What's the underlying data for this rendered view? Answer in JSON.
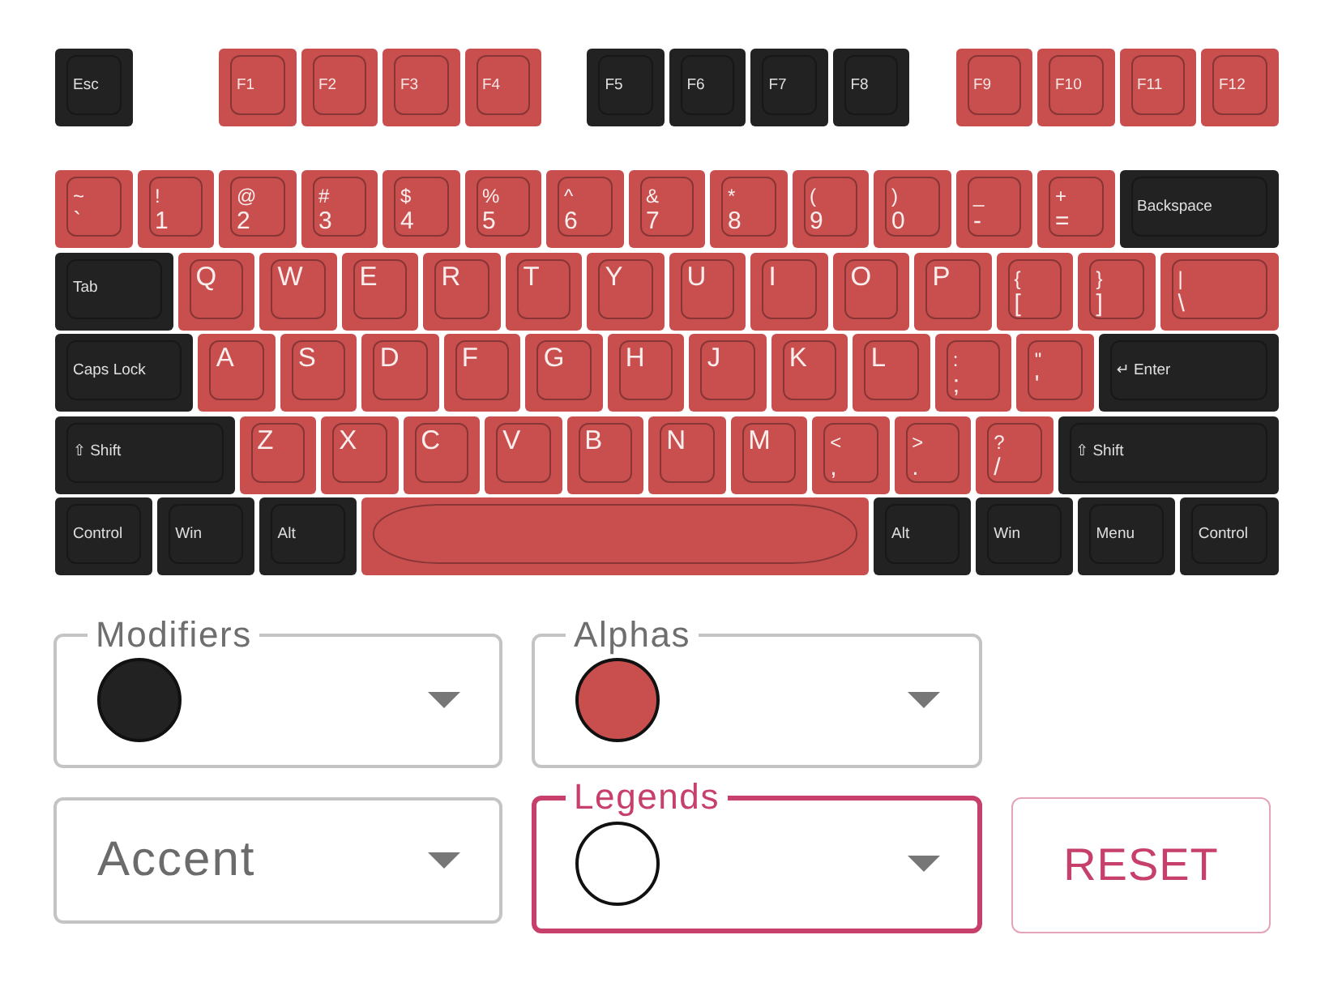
{
  "keyboard": {
    "rows": [
      {
        "keys": [
          {
            "kind": "modifier",
            "legends": [
              "Esc"
            ]
          },
          {
            "kind": "function",
            "legends": [
              "F1"
            ]
          },
          {
            "kind": "function",
            "legends": [
              "F2"
            ]
          },
          {
            "kind": "function",
            "legends": [
              "F3"
            ]
          },
          {
            "kind": "function",
            "legends": [
              "F4"
            ]
          },
          {
            "kind": "modifier",
            "legends": [
              "F5"
            ]
          },
          {
            "kind": "modifier",
            "legends": [
              "F6"
            ]
          },
          {
            "kind": "modifier",
            "legends": [
              "F7"
            ]
          },
          {
            "kind": "modifier",
            "legends": [
              "F8"
            ]
          },
          {
            "kind": "function",
            "legends": [
              "F9"
            ]
          },
          {
            "kind": "function",
            "legends": [
              "F10"
            ]
          },
          {
            "kind": "function",
            "legends": [
              "F11"
            ]
          },
          {
            "kind": "function",
            "legends": [
              "F12"
            ]
          }
        ]
      },
      {
        "keys": [
          {
            "kind": "pair",
            "legends": [
              "~",
              "`"
            ]
          },
          {
            "kind": "pair",
            "legends": [
              "!",
              "1"
            ]
          },
          {
            "kind": "pair",
            "legends": [
              "@",
              "2"
            ]
          },
          {
            "kind": "pair",
            "legends": [
              "#",
              "3"
            ]
          },
          {
            "kind": "pair",
            "legends": [
              "$",
              "4"
            ]
          },
          {
            "kind": "pair",
            "legends": [
              "%",
              "5"
            ]
          },
          {
            "kind": "pair",
            "legends": [
              "^",
              "6"
            ]
          },
          {
            "kind": "pair",
            "legends": [
              "&",
              "7"
            ]
          },
          {
            "kind": "pair",
            "legends": [
              "*",
              "8"
            ]
          },
          {
            "kind": "pair",
            "legends": [
              "(",
              "9"
            ]
          },
          {
            "kind": "pair",
            "legends": [
              ")",
              "0"
            ]
          },
          {
            "kind": "pair",
            "legends": [
              "_",
              "-"
            ]
          },
          {
            "kind": "pair",
            "legends": [
              "+",
              "="
            ]
          },
          {
            "kind": "modifier",
            "legends": [
              "Backspace"
            ]
          }
        ]
      },
      {
        "keys": [
          {
            "kind": "modifier",
            "legends": [
              "Tab"
            ]
          },
          {
            "kind": "letter",
            "legends": [
              "Q"
            ]
          },
          {
            "kind": "letter",
            "legends": [
              "W"
            ]
          },
          {
            "kind": "letter",
            "legends": [
              "E"
            ]
          },
          {
            "kind": "letter",
            "legends": [
              "R"
            ]
          },
          {
            "kind": "letter",
            "legends": [
              "T"
            ]
          },
          {
            "kind": "letter",
            "legends": [
              "Y"
            ]
          },
          {
            "kind": "letter",
            "legends": [
              "U"
            ]
          },
          {
            "kind": "letter",
            "legends": [
              "I"
            ]
          },
          {
            "kind": "letter",
            "legends": [
              "O"
            ]
          },
          {
            "kind": "letter",
            "legends": [
              "P"
            ]
          },
          {
            "kind": "pair",
            "legends": [
              "{",
              "["
            ]
          },
          {
            "kind": "pair",
            "legends": [
              "}",
              "]"
            ]
          },
          {
            "kind": "pair",
            "legends": [
              "|",
              "\\"
            ]
          }
        ]
      },
      {
        "keys": [
          {
            "kind": "modifier",
            "legends": [
              "Caps Lock"
            ]
          },
          {
            "kind": "letter",
            "legends": [
              "A"
            ]
          },
          {
            "kind": "letter",
            "legends": [
              "S"
            ]
          },
          {
            "kind": "letter",
            "legends": [
              "D"
            ]
          },
          {
            "kind": "letter",
            "legends": [
              "F"
            ]
          },
          {
            "kind": "letter",
            "legends": [
              "G"
            ]
          },
          {
            "kind": "letter",
            "legends": [
              "H"
            ]
          },
          {
            "kind": "letter",
            "legends": [
              "J"
            ]
          },
          {
            "kind": "letter",
            "legends": [
              "K"
            ]
          },
          {
            "kind": "letter",
            "legends": [
              "L"
            ]
          },
          {
            "kind": "pair",
            "legends": [
              ":",
              ";"
            ]
          },
          {
            "kind": "pair",
            "legends": [
              "\"",
              "'"
            ]
          },
          {
            "kind": "modifier",
            "legends": [
              "↵ Enter"
            ]
          }
        ]
      },
      {
        "keys": [
          {
            "kind": "modifier",
            "legends": [
              "⇧ Shift"
            ]
          },
          {
            "kind": "letter",
            "legends": [
              "Z"
            ]
          },
          {
            "kind": "letter",
            "legends": [
              "X"
            ]
          },
          {
            "kind": "letter",
            "legends": [
              "C"
            ]
          },
          {
            "kind": "letter",
            "legends": [
              "V"
            ]
          },
          {
            "kind": "letter",
            "legends": [
              "B"
            ]
          },
          {
            "kind": "letter",
            "legends": [
              "N"
            ]
          },
          {
            "kind": "letter",
            "legends": [
              "M"
            ]
          },
          {
            "kind": "pair",
            "legends": [
              "<",
              ","
            ]
          },
          {
            "kind": "pair",
            "legends": [
              ">",
              "."
            ]
          },
          {
            "kind": "pair",
            "legends": [
              "?",
              "/"
            ]
          },
          {
            "kind": "modifier",
            "legends": [
              "⇧ Shift"
            ]
          }
        ]
      },
      {
        "keys": [
          {
            "kind": "modifier",
            "legends": [
              "Control"
            ]
          },
          {
            "kind": "modifier",
            "legends": [
              "Win"
            ]
          },
          {
            "kind": "modifier",
            "legends": [
              "Alt"
            ]
          },
          {
            "kind": "space"
          },
          {
            "kind": "modifier",
            "legends": [
              "Alt"
            ]
          },
          {
            "kind": "modifier",
            "legends": [
              "Win"
            ]
          },
          {
            "kind": "modifier",
            "legends": [
              "Menu"
            ]
          },
          {
            "kind": "modifier",
            "legends": [
              "Control"
            ]
          }
        ]
      }
    ]
  },
  "pickers": [
    {
      "label": "Modifiers",
      "color": "#222222",
      "focused": false
    },
    {
      "label": "Accent",
      "focused": false
    },
    {
      "label": "Alphas",
      "color": "#c94f4f",
      "focused": false
    },
    {
      "label": "Legends",
      "color": "#ffffff",
      "focused": true
    }
  ],
  "reset_button": {
    "label": "RESET"
  }
}
